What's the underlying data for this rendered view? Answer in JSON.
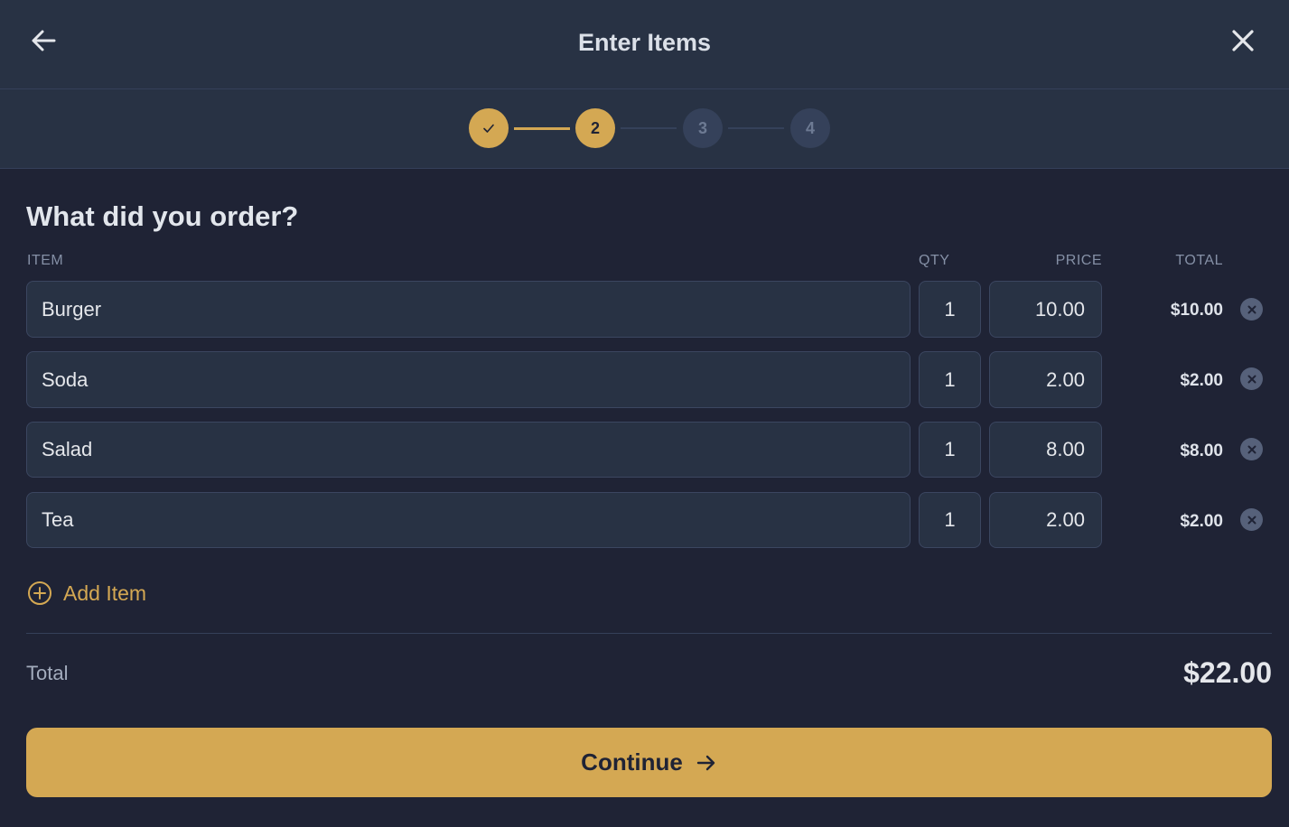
{
  "header": {
    "title": "Enter Items",
    "back_icon": "arrow-left-icon",
    "close_icon": "close-icon"
  },
  "stepper": {
    "steps": [
      {
        "label": "",
        "state": "done",
        "icon": "check-icon"
      },
      {
        "label": "2",
        "state": "active"
      },
      {
        "label": "3",
        "state": "pending"
      },
      {
        "label": "4",
        "state": "pending"
      }
    ],
    "current_step": 2,
    "total_steps": 4
  },
  "main": {
    "question": "What did you order?",
    "columns": {
      "item": "ITEM",
      "qty": "QTY",
      "price": "PRICE",
      "total": "TOTAL"
    },
    "items": [
      {
        "name": "Burger",
        "qty": "1",
        "price": "10.00",
        "total": "$10.00"
      },
      {
        "name": "Soda",
        "qty": "1",
        "price": "2.00",
        "total": "$2.00"
      },
      {
        "name": "Salad",
        "qty": "1",
        "price": "8.00",
        "total": "$8.00"
      },
      {
        "name": "Tea",
        "qty": "1",
        "price": "2.00",
        "total": "$2.00"
      }
    ],
    "add_item_label": "Add Item",
    "total_label": "Total",
    "total_value": "$22.00",
    "continue_label": "Continue"
  },
  "colors": {
    "accent": "#d4a853",
    "background": "#1f2335",
    "header_bg": "#283244",
    "input_bg": "#283244",
    "muted": "#8590a6"
  }
}
